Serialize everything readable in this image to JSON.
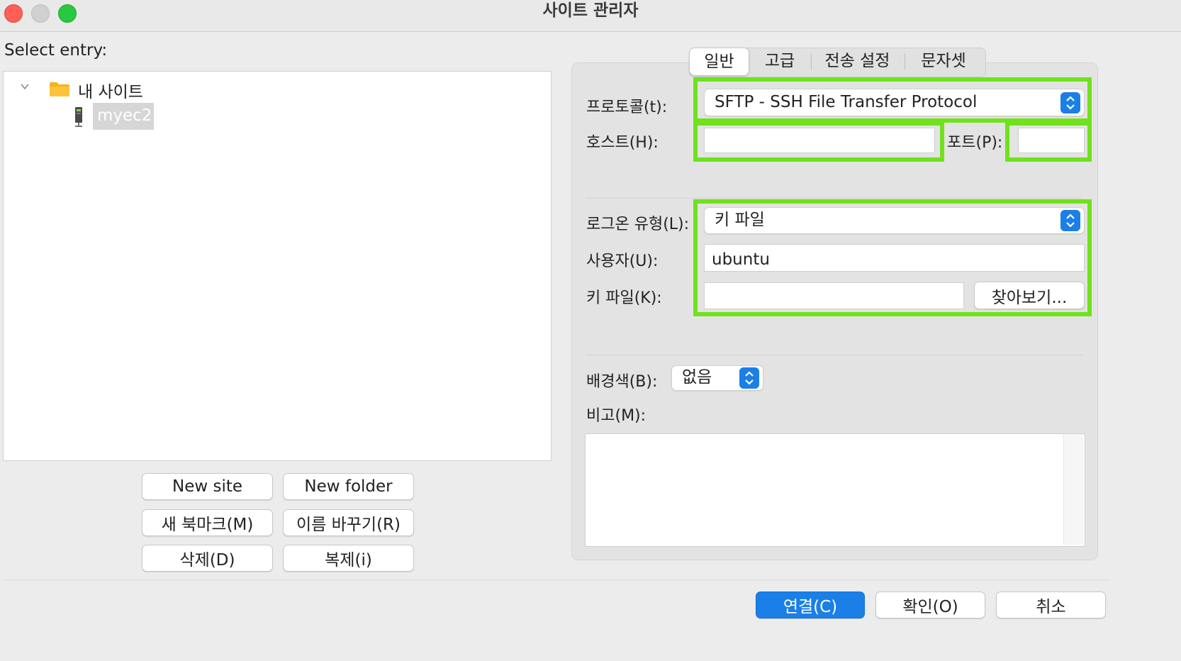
{
  "window": {
    "title": "사이트 관리자"
  },
  "left": {
    "select_label": "Select entry:",
    "tree": {
      "root": "내 사이트",
      "child": "myec2"
    },
    "buttons": {
      "new_site": "New site",
      "new_folder": "New folder",
      "new_bookmark": "새 북마크(M)",
      "rename": "이름 바꾸기(R)",
      "delete": "삭제(D)",
      "duplicate": "복제(i)"
    }
  },
  "tabs": [
    "일반",
    "고급",
    "전송 설정",
    "문자셋"
  ],
  "form": {
    "protocol_label": "프로토콜(t):",
    "protocol_value": "SFTP - SSH File Transfer Protocol",
    "host_label": "호스트(H):",
    "host_value": "",
    "port_label": "포트(P):",
    "port_value": "",
    "logon_label": "로그온 유형(L):",
    "logon_value": "키 파일",
    "user_label": "사용자(U):",
    "user_value": "ubuntu",
    "keyfile_label": "키 파일(K):",
    "keyfile_value": "",
    "browse_button": "찾아보기...",
    "bgcolor_label": "배경색(B):",
    "bgcolor_value": "없음",
    "memo_label": "비고(M):"
  },
  "footer": {
    "connect": "연결(C)",
    "ok": "확인(O)",
    "cancel": "취소"
  },
  "colors": {
    "highlight": "#6fe21c",
    "accent": "#1a7fe6"
  }
}
